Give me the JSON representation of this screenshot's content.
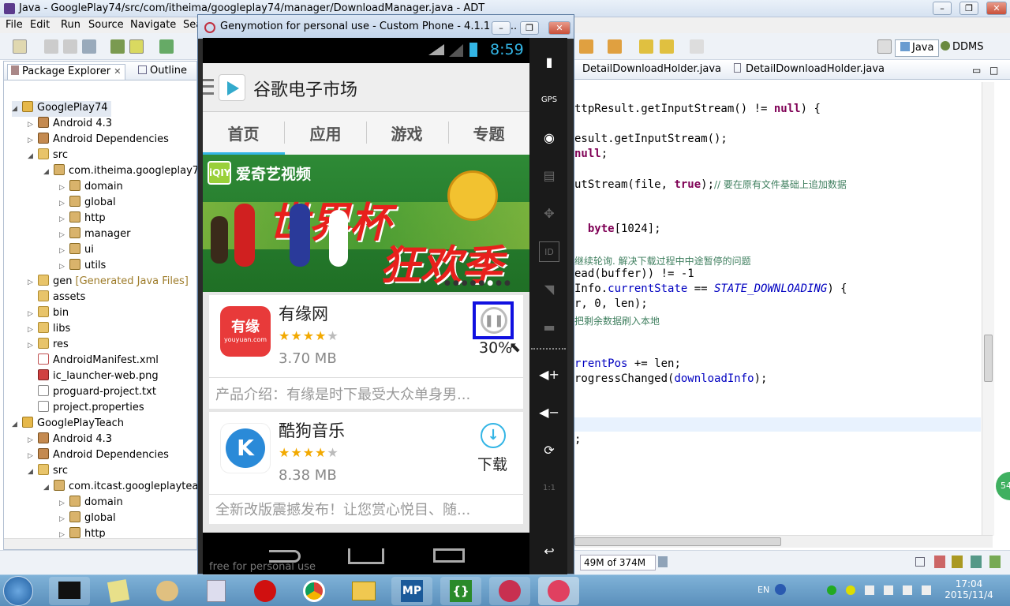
{
  "ide": {
    "title": "Java - GooglePlay74/src/com/itheima/googleplay74/manager/DownloadManager.java - ADT",
    "menu": [
      "File",
      "Edit",
      "Run",
      "Source",
      "Navigate",
      "Sea"
    ],
    "perspectives": {
      "java": "Java",
      "ddms": "DDMS"
    },
    "left_tabs": {
      "package_explorer": "Package Explorer",
      "outline": "Outline"
    },
    "tree": [
      {
        "label": "GooglePlay74",
        "type": "project"
      },
      {
        "label": "Android 4.3",
        "type": "lib"
      },
      {
        "label": "Android Dependencies",
        "type": "lib"
      },
      {
        "label": "src",
        "type": "folder"
      },
      {
        "label": "com.itheima.googleplay74",
        "type": "pkg"
      },
      {
        "label": "domain",
        "type": "pkg"
      },
      {
        "label": "global",
        "type": "pkg"
      },
      {
        "label": "http",
        "type": "pkg"
      },
      {
        "label": "manager",
        "type": "pkg"
      },
      {
        "label": "ui",
        "type": "pkg"
      },
      {
        "label": "utils",
        "type": "pkg"
      },
      {
        "label": "gen",
        "type": "folder",
        "extra": "[Generated Java Files]"
      },
      {
        "label": "assets",
        "type": "folder"
      },
      {
        "label": "bin",
        "type": "folder"
      },
      {
        "label": "libs",
        "type": "folder"
      },
      {
        "label": "res",
        "type": "folder"
      },
      {
        "label": "AndroidManifest.xml",
        "type": "xml"
      },
      {
        "label": "ic_launcher-web.png",
        "type": "img"
      },
      {
        "label": "proguard-project.txt",
        "type": "file"
      },
      {
        "label": "project.properties",
        "type": "file"
      },
      {
        "label": "GooglePlayTeach",
        "type": "project"
      },
      {
        "label": "Android 4.3",
        "type": "lib"
      },
      {
        "label": "Android Dependencies",
        "type": "lib"
      },
      {
        "label": "src",
        "type": "folder"
      },
      {
        "label": "com.itcast.googleplayteach",
        "type": "pkg"
      },
      {
        "label": "domain",
        "type": "pkg"
      },
      {
        "label": "global",
        "type": "pkg"
      },
      {
        "label": "http",
        "type": "pkg"
      }
    ],
    "editor_tabs": [
      "DetailDownloadHolder.java",
      "DetailDownloadHolder.java"
    ],
    "code": {
      "l1": "ttpResult.getInputStream() != ",
      "l1k": "null",
      "l1e": ") {",
      "l2": "esult.getInputStream();",
      "l3k": "null",
      "l3e": ";",
      "l4": "utStream(file, ",
      "l4k": "true",
      "l4e": ");",
      "l4c": "// 要在原有文件基础上追加数据",
      "l5k": "byte",
      "l5e": "[1024];",
      "l6c": "继续轮询. 解决下载过程中中途暂停的问题",
      "l7": "ead(buffer)) != -1",
      "l8a": "Info.",
      "l8f": "currentState",
      "l8b": " == ",
      "l8i": "STATE_DOWNLOADING",
      "l8e": ") {",
      "l9": "r, 0, len);",
      "l10c": "把剩余数据刷入本地",
      "l11f": "rrentPos",
      "l11e": " += len;",
      "l12a": "rogressChanged(",
      "l12f": "downloadInfo",
      "l12e": ");",
      "l13": ";"
    },
    "memory": "49M of 374M"
  },
  "emulator": {
    "title": "Genymotion for personal use - Custom Phone - 4.1.1 - A...",
    "time": "8:59",
    "app_title": "谷歌电子市场",
    "tabs": [
      "首页",
      "应用",
      "游戏",
      "专题"
    ],
    "banner": {
      "brand": "爱奇艺视频",
      "headline1": "世界杯",
      "headline2": "狂欢季"
    },
    "items": [
      {
        "name": "有缘网",
        "size": "3.70 MB",
        "action": "30%",
        "desc": "产品介绍：有缘是时下最受大众单身男...",
        "icon_text": "有缘",
        "icon_sub": "youyuan.com",
        "rating": 4
      },
      {
        "name": "酷狗音乐",
        "size": "8.38 MB",
        "action": "下载",
        "desc": "全新改版震撼发布！让您赏心悦目、随...",
        "icon_text": "K",
        "rating": 4
      }
    ],
    "watermark": "free for personal use"
  },
  "taskbar": {
    "lang": "EN",
    "time": "17:04",
    "date": "2015/11/4",
    "mp_label": "MP"
  },
  "colors": {
    "accent": "#33b5e5",
    "highlight_box": "#1010e0"
  }
}
